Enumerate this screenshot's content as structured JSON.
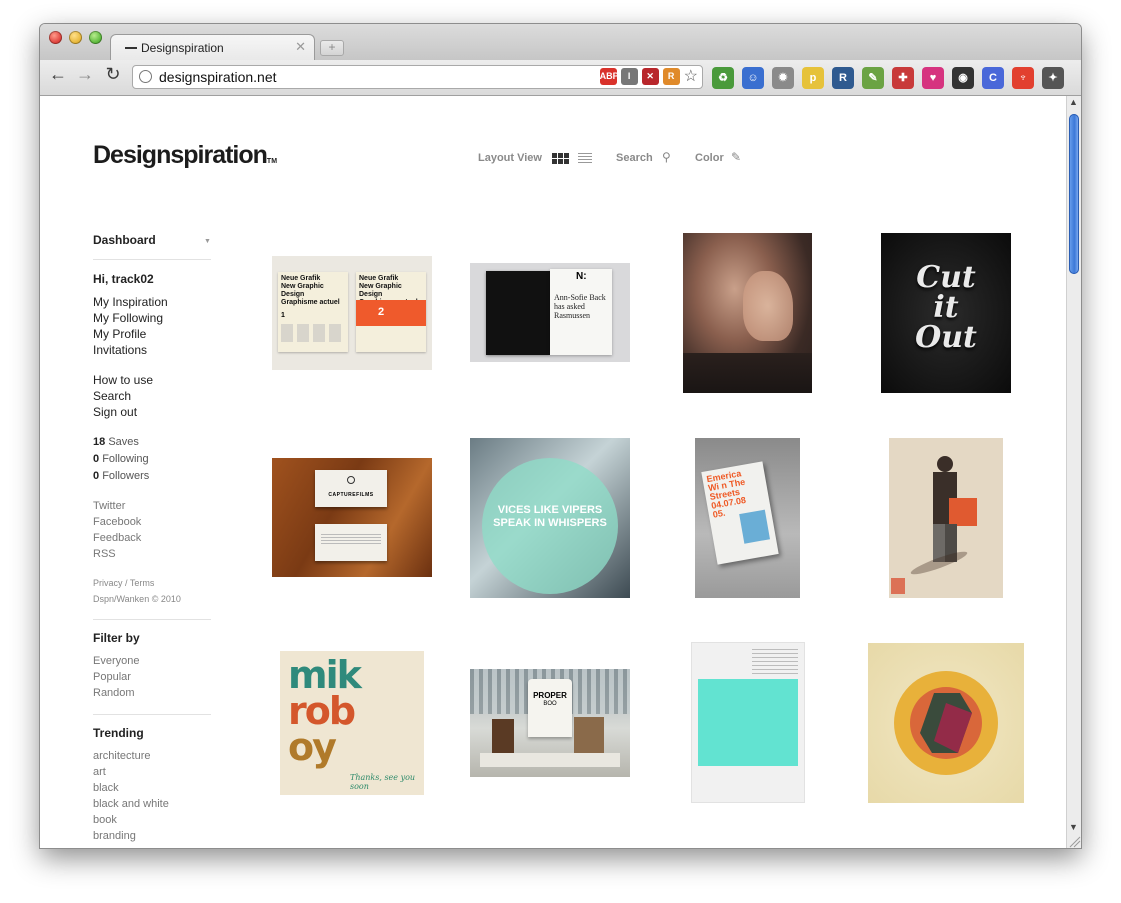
{
  "browser": {
    "tab_title": "Designspiration",
    "tab_close": "✕",
    "new_tab": "+",
    "back": "←",
    "forward": "→",
    "reload": "↻",
    "url": "designspiration.net",
    "omni_icons": [
      {
        "name": "adblock-icon",
        "label": "ABP",
        "color": "#d9322b"
      },
      {
        "name": "readability-icon",
        "label": "I",
        "color": "#777777"
      },
      {
        "name": "stop-icon",
        "label": "✕",
        "color": "#b8262b"
      },
      {
        "name": "rss-icon",
        "label": "R",
        "color": "#e08a2a"
      }
    ],
    "bookmark_star": "☆",
    "extensions": [
      {
        "name": "recycle-extension-icon",
        "label": "♻",
        "color": "#4a9a3b"
      },
      {
        "name": "face-extension-icon",
        "label": "☺",
        "color": "#3a6fd0"
      },
      {
        "name": "gear-extension-icon",
        "label": "✹",
        "color": "#8a8a8a"
      },
      {
        "name": "p-extension-icon",
        "label": "p",
        "color": "#e6c23a"
      },
      {
        "name": "r-extension-icon",
        "label": "R",
        "color": "#2f5a8f"
      },
      {
        "name": "evernote-extension-icon",
        "label": "✎",
        "color": "#6ba343"
      },
      {
        "name": "pin-extension-icon",
        "label": "✚",
        "color": "#c83a3a"
      },
      {
        "name": "heart-extension-icon",
        "label": "♥",
        "color": "#d6337f"
      },
      {
        "name": "color-wheel-extension-icon",
        "label": "◉",
        "color": "#333333"
      },
      {
        "name": "c-extension-icon",
        "label": "C",
        "color": "#4a68d9"
      },
      {
        "name": "shield-extension-icon",
        "label": "♆",
        "color": "#e2402f"
      },
      {
        "name": "wrench-icon",
        "label": "✦",
        "color": "#555555"
      }
    ],
    "scroll_up": "▲",
    "scroll_down": "▼"
  },
  "header": {
    "logo": "Designspiration",
    "logo_tm": "TM",
    "layout_view": "Layout View",
    "search": "Search",
    "color": "Color",
    "search_glyph": "⚲",
    "pen_glyph": "✎"
  },
  "sidebar": {
    "dashboard": "Dashboard",
    "dashboard_caret": "▼",
    "greeting": "Hi, track02",
    "account_links": [
      "My Inspiration",
      "My Following",
      "My Profile",
      "Invitations"
    ],
    "help_links": [
      "How to use",
      "Search",
      "Sign out"
    ],
    "stats": [
      {
        "num": "18",
        "label": "Saves"
      },
      {
        "num": "0",
        "label": "Following"
      },
      {
        "num": "0",
        "label": "Followers"
      }
    ],
    "social_links": [
      "Twitter",
      "Facebook",
      "Feedback",
      "RSS"
    ],
    "legal": "Privacy  / Terms",
    "copyright": "Dspn/Wanken © 2010",
    "filter_title": "Filter by",
    "filters": [
      "Everyone",
      "Popular",
      "Random"
    ],
    "trending_title": "Trending",
    "trending": [
      "architecture",
      "art",
      "black",
      "black and white",
      "book",
      "branding"
    ]
  },
  "grid": {
    "thumb1": {
      "line1": "Neue Grafik",
      "line2": "New Graphic Design",
      "line3": "Graphisme actuel",
      "n1": "1",
      "n2": "2"
    },
    "thumb2": {
      "letter": "N:",
      "text": "Ann-Sofie Back\nhas asked\nRasmussen"
    },
    "thumb5": {
      "brand": "CAPTUREFILMS"
    },
    "thumb6": {
      "line1": "VICES LIKE VIPERS",
      "line2": "SPEAK IN WHISPERS"
    },
    "thumb7": {
      "line1": "Emerica",
      "line2": "Wi n The",
      "line3": "Streets",
      "line4": "04.07.08",
      "line5": "05."
    },
    "thumb9": {
      "line1": "mik",
      "line2": "rob",
      "line3": "oy",
      "sig": "Thanks, see you soon"
    },
    "thumb10": {
      "brand": "PROPER",
      "sub": "BOO"
    }
  }
}
